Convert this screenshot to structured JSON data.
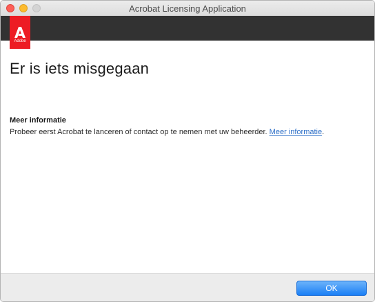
{
  "window": {
    "title": "Acrobat Licensing Application"
  },
  "brand": {
    "logo_text": "Adobe",
    "logo_color": "#ed1c24",
    "header_color": "#323232"
  },
  "main": {
    "heading": "Er is iets misgegaan",
    "info_title": "Meer informatie",
    "info_text": "Probeer eerst Acrobat te lanceren of contact op te nemen met uw beheerder. ",
    "info_link": "Meer informatie",
    "info_suffix": "."
  },
  "footer": {
    "ok_label": "OK",
    "accent_color": "#1b7ff5"
  }
}
